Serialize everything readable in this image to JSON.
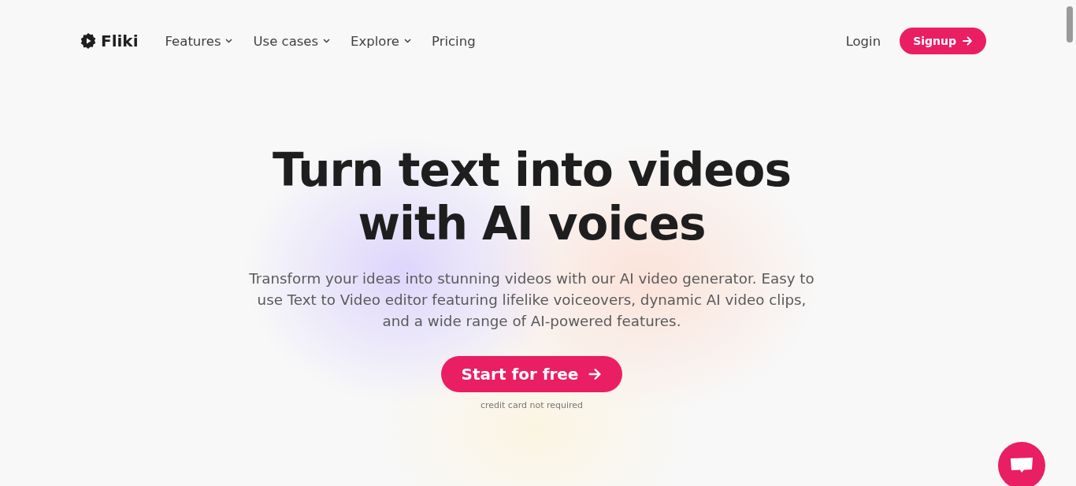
{
  "header": {
    "logo": "Fliki",
    "nav": [
      {
        "label": "Features",
        "has_menu": true
      },
      {
        "label": "Use cases",
        "has_menu": true
      },
      {
        "label": "Explore",
        "has_menu": true
      },
      {
        "label": "Pricing",
        "has_menu": false
      }
    ],
    "login": "Login",
    "signup": "Signup"
  },
  "hero": {
    "title_lines": [
      "Turn text into videos",
      "with AI voices"
    ],
    "subtitle": "Transform your ideas into stunning videos with our AI video generator. Easy to use Text to Video editor featuring lifelike voiceovers, dynamic AI video clips, and a wide range of AI-powered features.",
    "cta": "Start for free",
    "note": "credit card not required"
  }
}
